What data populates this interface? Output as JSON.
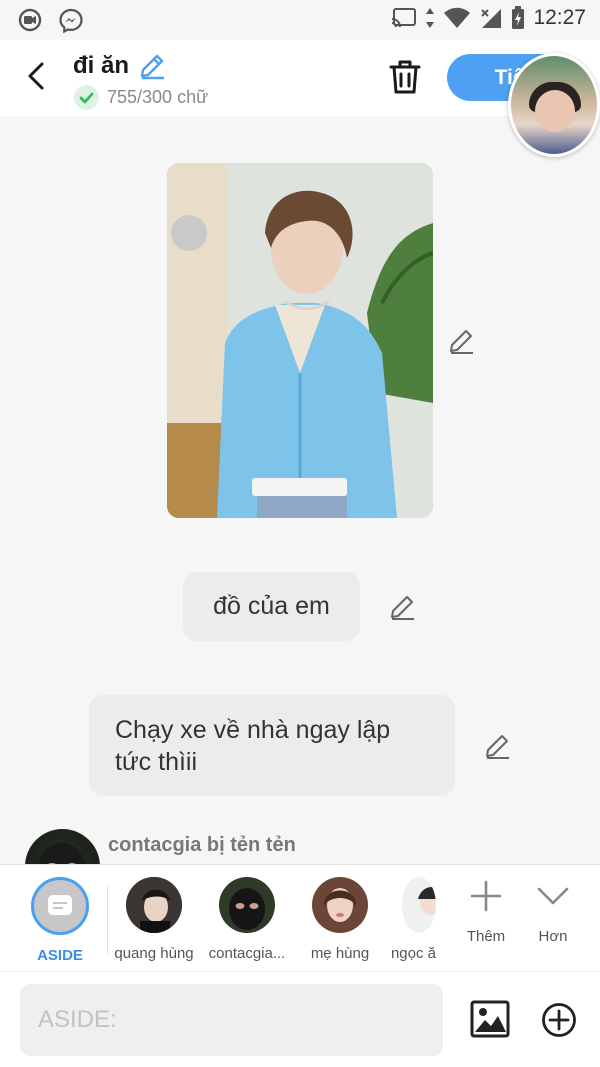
{
  "status_bar": {
    "time": "12:27"
  },
  "header": {
    "title": "đi ăn",
    "word_count": "755/300 chữ",
    "next_label": "Tiếp"
  },
  "messages": [
    {
      "type": "image",
      "description_icon": "photo"
    },
    {
      "type": "text",
      "text": "đồ của em"
    },
    {
      "type": "text",
      "text": "Chạy xe về nhà ngay lập tức thìii"
    }
  ],
  "next_sender": {
    "name": "contacgia bị tẻn tẻn"
  },
  "characters": [
    {
      "label": "ASIDE",
      "selected": true
    },
    {
      "label": "quang hùng"
    },
    {
      "label": "contacgia..."
    },
    {
      "label": "mẹ hùng"
    },
    {
      "label": "ngọc ă"
    }
  ],
  "actions": {
    "more_label": "Thêm",
    "less_label": "Hơn"
  },
  "input": {
    "placeholder": "ASIDE:"
  },
  "colors": {
    "accent": "#4da0f2",
    "bubble": "#ececec"
  }
}
